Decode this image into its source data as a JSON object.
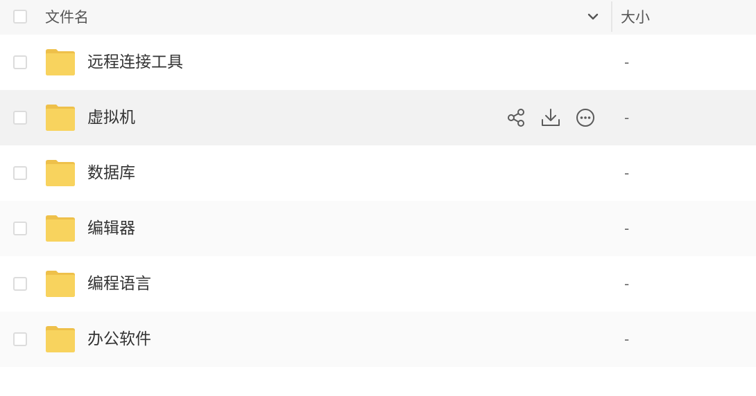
{
  "header": {
    "name_label": "文件名",
    "size_label": "大小"
  },
  "rows": [
    {
      "name": "远程连接工具",
      "size": "-"
    },
    {
      "name": "虚拟机",
      "size": "-"
    },
    {
      "name": "数据库",
      "size": "-"
    },
    {
      "name": "编辑器",
      "size": "-"
    },
    {
      "name": "编程语言",
      "size": "-"
    },
    {
      "name": "办公软件",
      "size": "-"
    }
  ],
  "icons": {
    "folder": "folder-icon",
    "share": "share-icon",
    "download": "download-icon",
    "more": "more-icon",
    "sort": "chevron-down-icon"
  },
  "colors": {
    "folder": "#f8d35e",
    "folder_tab": "#eec04a",
    "icon_stroke": "#5a5a5a"
  }
}
